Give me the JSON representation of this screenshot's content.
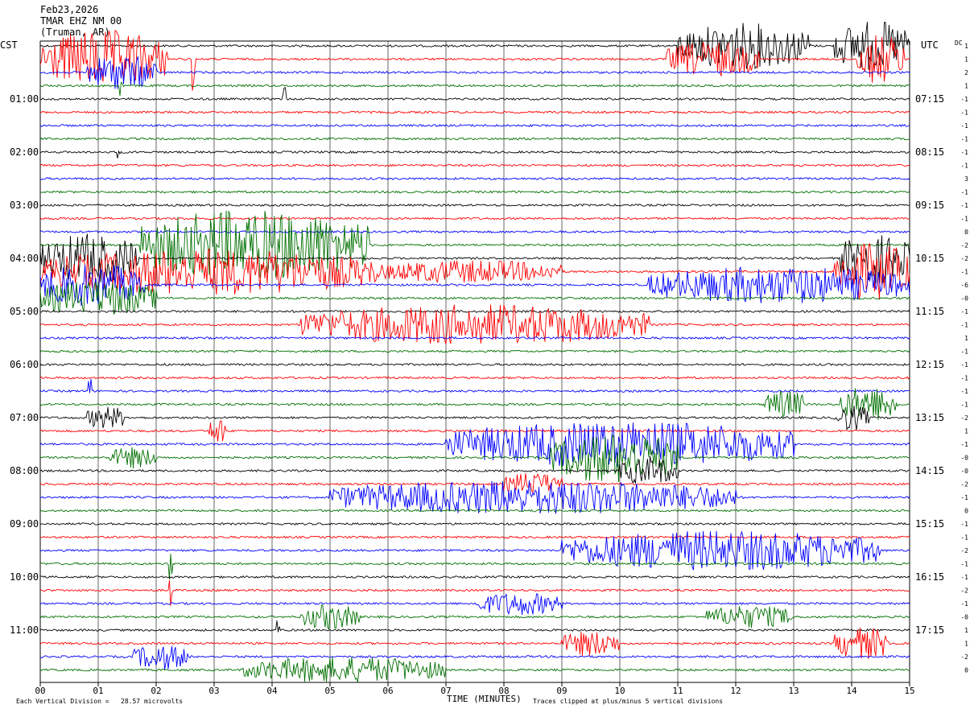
{
  "header": {
    "date": "Feb23,2026",
    "station": "TMAR EHZ NM 00",
    "location": "(Truman, AR)"
  },
  "left_tz": "CST",
  "right_tz": "UTC",
  "dc_label": "DC",
  "footer": {
    "scale": "Each Vertical Division =   28.57 microvolts",
    "xlabel": "TIME (MINUTES)",
    "clip_note": "Traces clipped at plus/minus 5 vertical divisions"
  },
  "colors": {
    "trace_cycle": [
      "#000000",
      "#ff0000",
      "#0000ff",
      "#007000"
    ],
    "grid": "#000000"
  },
  "chart_data": {
    "type": "line",
    "title": "",
    "xlabel": "TIME (MINUTES)",
    "xlim": [
      0,
      15
    ],
    "x_ticks": [
      "00",
      "01",
      "02",
      "03",
      "04",
      "05",
      "06",
      "07",
      "08",
      "09",
      "10",
      "11",
      "12",
      "13",
      "14",
      "15"
    ],
    "lines_per_hour": 4,
    "minutes_per_line": 15,
    "left_hour_labels": [
      "01:00",
      "02:00",
      "03:00",
      "04:00",
      "05:00",
      "06:00",
      "07:00",
      "08:00",
      "09:00",
      "10:00",
      "11:00"
    ],
    "right_hour_labels": [
      "07:15",
      "08:15",
      "09:15",
      "10:15",
      "11:15",
      "12:15",
      "13:15",
      "14:15",
      "15:15",
      "16:15",
      "17:15"
    ],
    "dc_offsets": [
      "1",
      "1",
      "2",
      "1",
      "-1",
      "-1",
      "-1",
      "-1",
      "-1",
      "-1",
      "3",
      "-1",
      "-1",
      "-1",
      "0",
      "-2",
      "-2",
      "-1",
      "-6",
      "-0",
      "-1",
      "-1",
      "1",
      "-1",
      "-1",
      "-1",
      "-1",
      "-1",
      "-2",
      "1",
      "-1",
      "-0",
      "-0",
      "-2",
      "-1",
      "0",
      "-1",
      "-1",
      "-2",
      "-1",
      "-1",
      "-2",
      "-1",
      "-0",
      "1",
      "1",
      "-2",
      "0"
    ],
    "activity": [
      {
        "line": 0,
        "segments": [
          [
            11.0,
            13.3,
            3.2
          ],
          [
            13.7,
            15.0,
            3.5
          ]
        ]
      },
      {
        "line": 1,
        "segments": [
          [
            0.0,
            2.2,
            4.0
          ],
          [
            10.8,
            12.4,
            2.5
          ],
          [
            14.1,
            14.9,
            3.5
          ]
        ]
      },
      {
        "line": 2,
        "segments": [
          [
            0.8,
            2.0,
            2.5
          ]
        ]
      },
      {
        "line": 3,
        "segments": []
      },
      {
        "line": 15,
        "segments": [
          [
            1.7,
            5.7,
            5.0
          ]
        ]
      },
      {
        "line": 16,
        "segments": [
          [
            0.0,
            1.7,
            3.5
          ],
          [
            13.8,
            15.0,
            3.5
          ]
        ]
      },
      {
        "line": 17,
        "segments": [
          [
            0.0,
            5.8,
            3.2
          ],
          [
            5.8,
            9.0,
            1.6
          ],
          [
            13.7,
            15.0,
            4.0
          ]
        ]
      },
      {
        "line": 18,
        "segments": [
          [
            0.0,
            1.8,
            3.0
          ],
          [
            10.5,
            15.0,
            2.6
          ]
        ]
      },
      {
        "line": 19,
        "segments": [
          [
            0.0,
            2.0,
            2.5
          ]
        ]
      },
      {
        "line": 21,
        "segments": [
          [
            4.5,
            10.5,
            2.8
          ]
        ]
      },
      {
        "line": 27,
        "segments": [
          [
            12.5,
            13.2,
            2.0
          ],
          [
            13.8,
            14.8,
            2.5
          ]
        ]
      },
      {
        "line": 28,
        "segments": [
          [
            0.8,
            1.5,
            1.6
          ],
          [
            13.7,
            14.3,
            1.8
          ]
        ]
      },
      {
        "line": 29,
        "segments": [
          [
            2.9,
            3.2,
            2.0
          ]
        ]
      },
      {
        "line": 30,
        "segments": [
          [
            7.0,
            13.0,
            3.2
          ]
        ]
      },
      {
        "line": 31,
        "segments": [
          [
            1.2,
            2.0,
            1.5
          ],
          [
            8.8,
            11.0,
            3.5
          ]
        ]
      },
      {
        "line": 32,
        "segments": [
          [
            10.0,
            11.0,
            2.0
          ]
        ]
      },
      {
        "line": 33,
        "segments": [
          [
            8.0,
            9.0,
            1.6
          ]
        ]
      },
      {
        "line": 34,
        "segments": [
          [
            5.0,
            12.0,
            2.4
          ]
        ]
      },
      {
        "line": 38,
        "segments": [
          [
            9.0,
            14.5,
            2.8
          ]
        ]
      },
      {
        "line": 42,
        "segments": [
          [
            7.5,
            9.0,
            1.6
          ]
        ]
      },
      {
        "line": 43,
        "segments": [
          [
            4.5,
            5.5,
            1.8
          ],
          [
            11.5,
            13.0,
            1.6
          ]
        ]
      },
      {
        "line": 45,
        "segments": [
          [
            9.0,
            10.0,
            1.8
          ],
          [
            13.7,
            14.7,
            2.2
          ]
        ]
      },
      {
        "line": 46,
        "segments": [
          [
            1.6,
            2.6,
            1.8
          ]
        ]
      },
      {
        "line": 47,
        "segments": [
          [
            3.5,
            7.0,
            1.8
          ]
        ]
      }
    ],
    "spikes": [
      {
        "line": 1,
        "minute": 2.65,
        "amp": 8
      },
      {
        "line": 3,
        "minute": 1.4,
        "amp": 2
      },
      {
        "line": 4,
        "minute": 4.2,
        "amp": 2.5
      },
      {
        "line": 8,
        "minute": 1.35,
        "amp": 1.8
      },
      {
        "line": 26,
        "minute": 0.85,
        "amp": 2.2
      },
      {
        "line": 39,
        "minute": 2.25,
        "amp": 2.5
      },
      {
        "line": 41,
        "minute": 2.25,
        "amp": 3
      },
      {
        "line": 44,
        "minute": 4.1,
        "amp": 1.8
      }
    ]
  }
}
